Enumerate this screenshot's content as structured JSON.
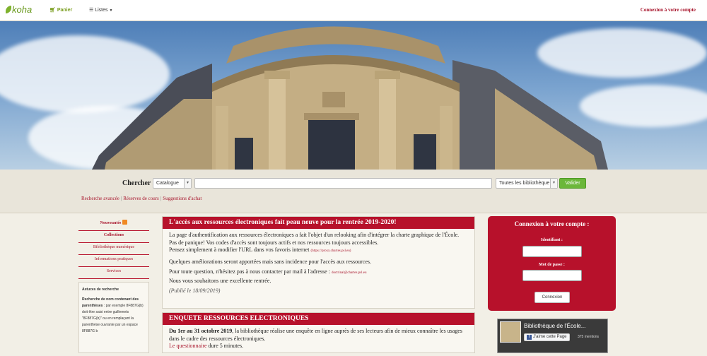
{
  "navbar": {
    "logo": "koha",
    "cart": "Panier",
    "lists": "Listes",
    "login": "Connexion à votre compte"
  },
  "search": {
    "label": "Chercher",
    "catalog_select": "Catalogue",
    "library_select": "Toutes les bibliothèque",
    "submit": "Valider",
    "links": [
      "Recherche avancée",
      "Réserves de cours",
      "Suggestions d'achat"
    ]
  },
  "sidebar": {
    "items": [
      "Nouveautés",
      "Collections",
      "Bibliothèque numérique",
      "Informations pratiques",
      "Services"
    ],
    "tips_title": "Astuces de recherche",
    "tips_lead": "Recherche de nom contenant des parenthèses",
    "tips_text": " : par exemple 8F887G(b) doit être saisi entre guillemets \"8F887G(b)\" ou en remplaçant la parenthèse ouvrante par un espace 8F887G b"
  },
  "news": [
    {
      "title": "L'accès aux ressources électroniques fait peau neuve pour la rentrée 2019-2020!",
      "p1": "La page d'authentification aux ressources électroniques a fait l'objet d'un relooking afin d'intégrer la charte graphique de l'École.",
      "p2": "Pas de panique! Vos codes d'accès sont toujours actifs et nos ressources toujours accessibles.",
      "p3": "Pensez simplement à modifier l'URL dans vos favoris internet",
      "p3_url": "(https://proxy.chartes.psl.eu)",
      "p4": "Quelques améliorations seront apportées mais sans incidence pour l'accès aux ressources.",
      "p5": "Pour toute question, n'hésitez pas à nous contacter par mail à l'adresse :",
      "p5_mail": "doctrinal@chartes.psl.eu",
      "p6": "Nous vous souhaitons une excellente rentrée.",
      "date": "(Publié le 18/09/2019)"
    },
    {
      "title": "ENQUETE RESSOURCES ELECTRONIQUES",
      "p1_bold": "Du 1er au 31 octobre 2019",
      "p1": ", la bibliothèque réalise une enquête en ligne auprès de ses lecteurs afin de mieux connaître les usages dans le cadre des ressources électroniques.",
      "p2_link": "Le questionnaire",
      "p2": " dure 5 minutes."
    }
  ],
  "login_box": {
    "title": "Connexion à votre compte :",
    "id_label": "Identifiant :",
    "pw_label": "Mot de passe :",
    "button": "Connexion"
  },
  "facebook": {
    "page_name": "Bibliothèque de l'École...",
    "like": "J'aime cette Page",
    "count": "375 mentions"
  }
}
